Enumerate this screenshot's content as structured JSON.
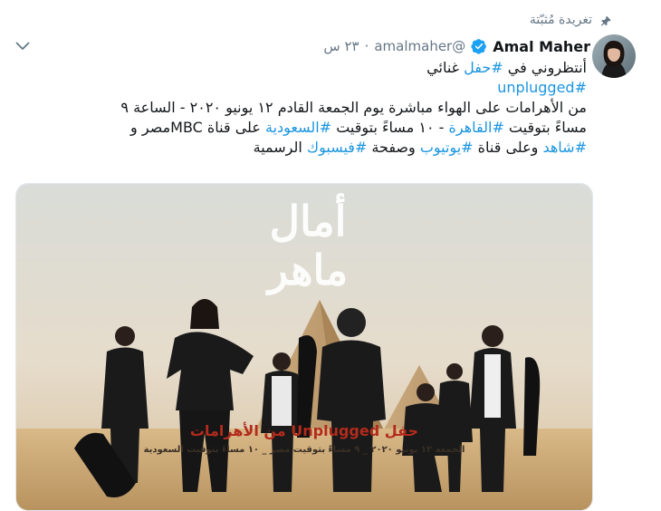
{
  "pinned": {
    "label": "تغريدة مُثبّتة",
    "icon": "pin-icon"
  },
  "menu": {
    "icon": "chevron-down-icon"
  },
  "author": {
    "name": "Amal Maher",
    "handle": "@amalmaher",
    "verified": true,
    "timestamp": "٢٣ س"
  },
  "tweet": {
    "line1_text": "أنتظروني في ",
    "line1_tag": "#حفل",
    "line1_end": " غنائي",
    "line2_tag": "#unplugged",
    "line3": "من الأهرامات على الهواء مباشرة يوم الجمعة القادم ١٢ يونيو ٢٠٢٠ - الساعة ٩",
    "line4_a": "مساءً بتوقيت ",
    "line4_tag1": "#القاهرة",
    "line4_b": " - ١٠ مساءً بتوقيت ",
    "line4_tag2": "#السعودية",
    "line4_c": " على قناة MBCمصر  و",
    "line5_tag1": "#شاهد",
    "line5_a": " وعلى قناة ",
    "line5_tag2": "#يوتيوب",
    "line5_b": " وصفحة ",
    "line5_tag3": "#فيسبوك",
    "line5_c": " الرسمية"
  },
  "poster": {
    "logo_text": "أمال ماهر",
    "title": "حفل Unplugged من الأهرامات",
    "date_line": "الجمعة ١٢ يونيو ٢٠٢٠ _ ٩ مساءً بتوقيت مصر _ ١٠ مساءً بتوقيت السعودية"
  },
  "colors": {
    "link": "#1b95e0",
    "secondary": "#657786",
    "verified": "#1da1f2"
  }
}
